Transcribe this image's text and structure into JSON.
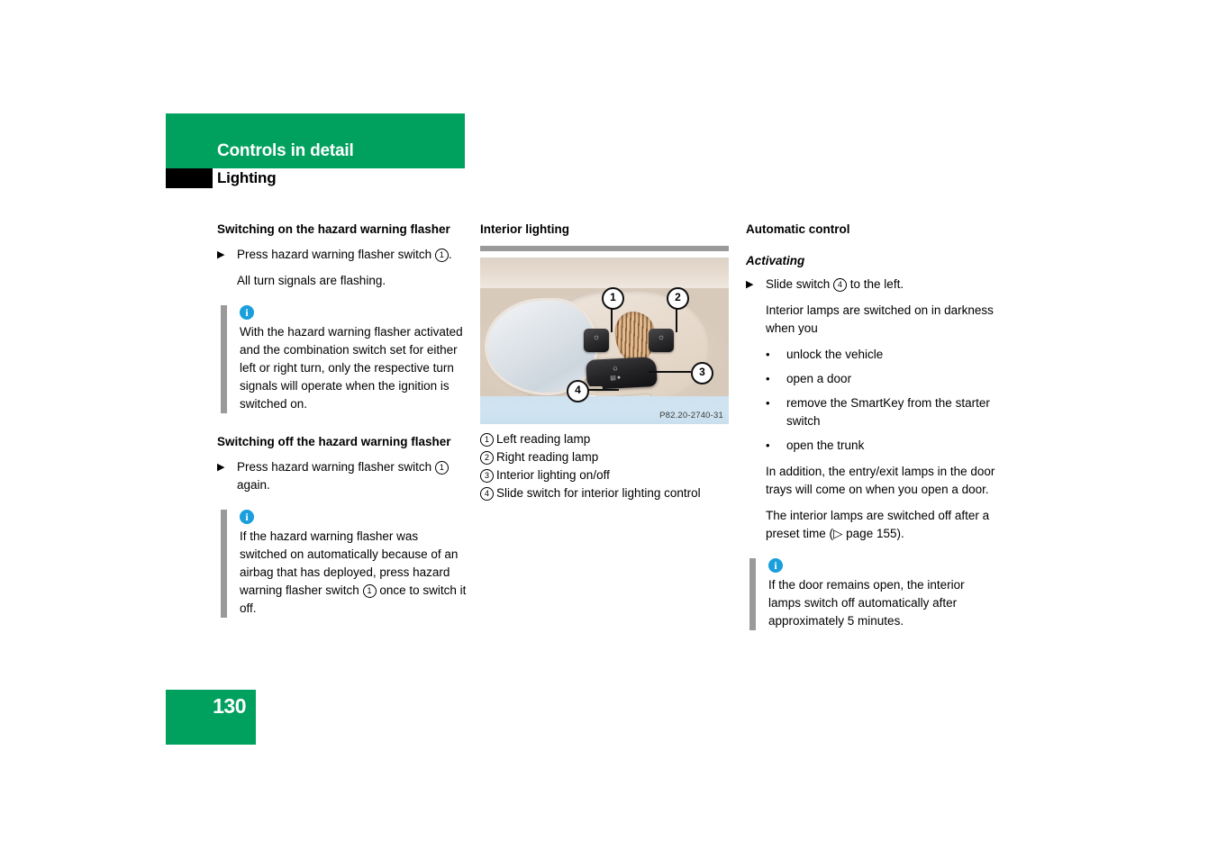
{
  "header": {
    "chapter_title": "Controls in detail",
    "section_title": "Lighting",
    "black_tab": "black-index-tab"
  },
  "columns": {
    "left": {
      "heading_on": "Switching on the hazard warning flasher",
      "step_on_marker": "▶",
      "step_on_text_a": "Press hazard warning flasher switch ",
      "step_on_circ": "1",
      "step_on_text_b": ".",
      "result_on": "All turn signals are flashing.",
      "note_on_icon": "i",
      "note_on_text": "With the hazard warning flasher activated and the combination switch set for either left or right turn, only the respective turn signals will operate when the ignition is switched on.",
      "heading_off": "Switching off the hazard warning flasher",
      "step_off_marker": "▶",
      "step_off_text_a": "Press hazard warning flasher switch ",
      "step_off_circ": "1",
      "step_off_text_b": " again.",
      "note_off_icon": "i",
      "note_off_text_a": "If the hazard warning flasher was switched on automatically because of an airbag that has deployed, press hazard warning flasher switch ",
      "note_off_circ": "1",
      "note_off_text_b": " once to switch it off."
    },
    "middle": {
      "heading": "Interior lighting",
      "image_code": "P82.20-2740-31",
      "callouts": [
        "1",
        "2",
        "3",
        "4"
      ],
      "legend": [
        {
          "num": "1",
          "label": "Left reading lamp"
        },
        {
          "num": "2",
          "label": "Right reading lamp"
        },
        {
          "num": "3",
          "label": "Interior lighting on/off"
        },
        {
          "num": "4",
          "label": "Slide switch for interior lighting control"
        }
      ]
    },
    "right": {
      "heading": "Automatic control",
      "subheading": "Activating",
      "step_marker": "▶",
      "step_text_a": "Slide switch ",
      "step_circ": "4",
      "step_text_b": " to the left.",
      "intro": "Interior lamps are switched on in darkness when you",
      "bullets": [
        "unlock the vehicle",
        "open a door",
        "remove the SmartKey from the starter switch",
        "open the trunk"
      ],
      "para_addition": "In addition, the entry/exit lamps in the door trays will come on when you open a door.",
      "para_preset_a": "The interior lamps are switched off after a preset time (",
      "para_preset_ref": "▷ page 155",
      "para_preset_b": ").",
      "note_icon": "i",
      "note_text": "If the door remains open, the interior lamps switch off automatically after approximately 5 minutes."
    }
  },
  "footer": {
    "page_number": "130"
  },
  "colors": {
    "brand_green": "#00a05e",
    "note_bar_gray": "#9a9a9a",
    "info_icon_blue": "#1a9fdc",
    "tab_black": "#000000"
  }
}
